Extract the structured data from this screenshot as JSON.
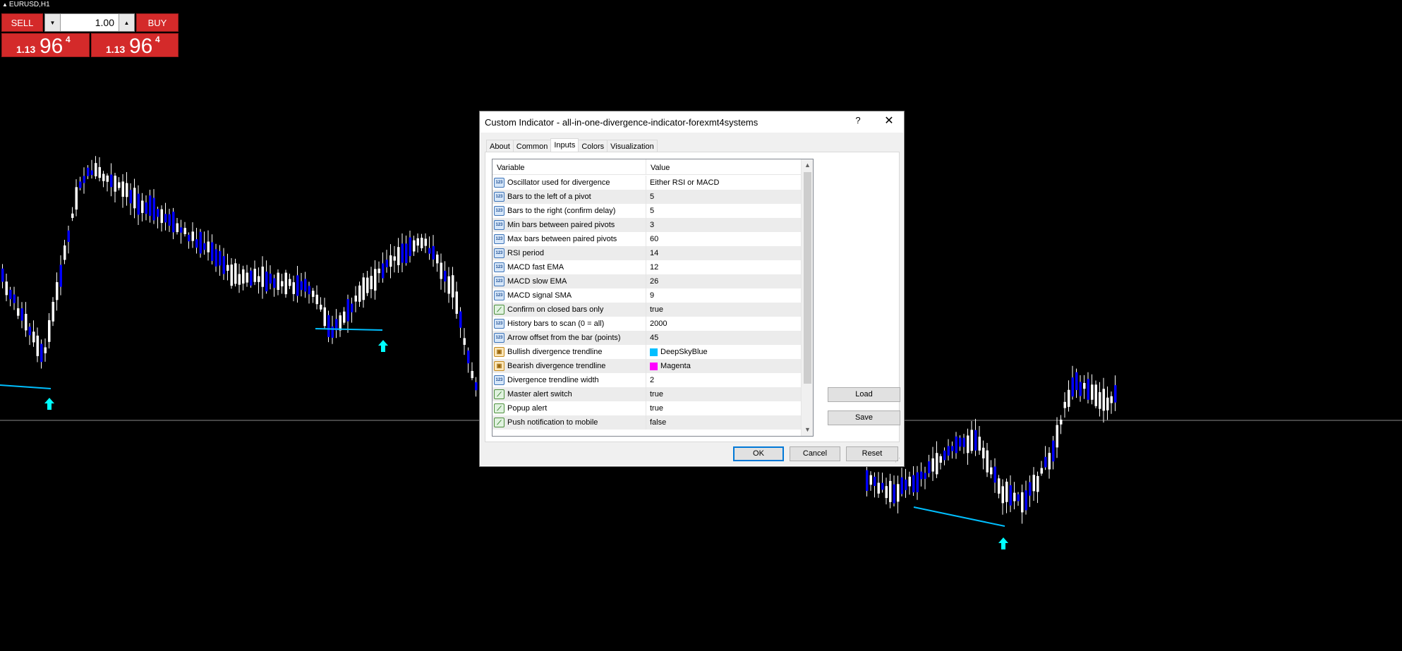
{
  "chart": {
    "symbol": "EURUSD,H1",
    "colors": {
      "background": "#000000",
      "bull_candle": "#0000ff",
      "bear_candle": "#ffffff",
      "trendline": "#00bfff",
      "arrow": "#00ffff",
      "wick": "#ffffff"
    }
  },
  "trade_panel": {
    "sell_label": "SELL",
    "buy_label": "BUY",
    "lot": "1.00",
    "sell_price_small": "1.13",
    "sell_price_big": "96",
    "sell_price_sup": "4",
    "buy_price_small": "1.13",
    "buy_price_big": "96",
    "buy_price_sup": "4",
    "color": "#d42a2a"
  },
  "dialog": {
    "title": "Custom Indicator - all-in-one-divergence-indicator-forexmt4systems",
    "help": "?",
    "close": "✕",
    "tabs": [
      {
        "label": "About"
      },
      {
        "label": "Common"
      },
      {
        "label": "Inputs",
        "active": true
      },
      {
        "label": "Colors"
      },
      {
        "label": "Visualization"
      }
    ],
    "columns": {
      "variable": "Variable",
      "value": "Value"
    },
    "rows": [
      {
        "type": "int",
        "variable": "Oscillator used for divergence",
        "value": "Either RSI or MACD"
      },
      {
        "type": "int",
        "variable": "Bars to the left of a pivot",
        "value": "5"
      },
      {
        "type": "int",
        "variable": "Bars to the right (confirm delay)",
        "value": "5"
      },
      {
        "type": "int",
        "variable": "Min bars between paired pivots",
        "value": "3"
      },
      {
        "type": "int",
        "variable": "Max bars between paired pivots",
        "value": "60"
      },
      {
        "type": "int",
        "variable": "RSI period",
        "value": "14"
      },
      {
        "type": "int",
        "variable": "MACD fast EMA",
        "value": "12"
      },
      {
        "type": "int",
        "variable": "MACD slow EMA",
        "value": "26"
      },
      {
        "type": "int",
        "variable": "MACD signal SMA",
        "value": "9"
      },
      {
        "type": "bool",
        "variable": "Confirm on closed bars only",
        "value": "true"
      },
      {
        "type": "int",
        "variable": "History bars to scan (0 = all)",
        "value": "2000"
      },
      {
        "type": "int",
        "variable": "Arrow offset from the bar (points)",
        "value": "45"
      },
      {
        "type": "color",
        "variable": "Bullish divergence trendline",
        "value": "DeepSkyBlue",
        "swatch": "#00bfff"
      },
      {
        "type": "color",
        "variable": "Bearish divergence trendline",
        "value": "Magenta",
        "swatch": "#ff00ff"
      },
      {
        "type": "int",
        "variable": "Divergence trendline width",
        "value": "2"
      },
      {
        "type": "bool",
        "variable": "Master alert switch",
        "value": "true"
      },
      {
        "type": "bool",
        "variable": "Popup alert",
        "value": "true"
      },
      {
        "type": "bool",
        "variable": "Push notification to mobile",
        "value": "false"
      }
    ],
    "buttons": {
      "load": "Load",
      "save": "Save",
      "ok": "OK",
      "cancel": "Cancel",
      "reset": "Reset"
    }
  }
}
